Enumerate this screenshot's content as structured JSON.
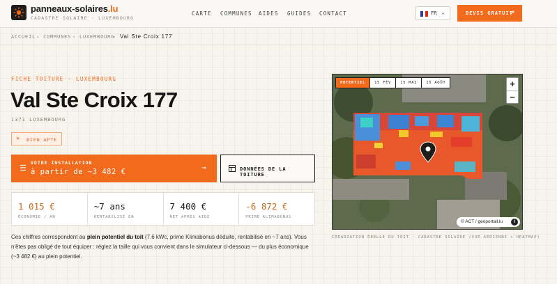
{
  "brand": {
    "name": "panneaux-solaires",
    "tld": ".lu",
    "subtitle": "CADASTRE SOLAIRE · LUXEMBOURG"
  },
  "nav": [
    "CARTE",
    "COMMUNES",
    "AIDES",
    "GUIDES",
    "CONTACT"
  ],
  "lang": {
    "code": "FR",
    "flag_colors": [
      "#2a3f91",
      "#ffffff",
      "#e1261c"
    ]
  },
  "cta": {
    "label": "DEVIS GRATUIT",
    "arrow": "↗"
  },
  "breadcrumb": [
    "ACCUEIL",
    "COMMUNES",
    "LUXEMBOURG",
    "Val Ste Croix 177"
  ],
  "breadcrumb_sep": "›",
  "eyebrow": "FICHE TOITURE · LUXEMBOURG",
  "title": "Val Ste Croix 177",
  "locality": "1371 LUXEMBOURG",
  "badge": {
    "label": "BIEN APTE",
    "icon": "sun-icon"
  },
  "install": {
    "label": "VOTRE INSTALLATION",
    "price": "à partir de ~3 482 €",
    "icon": "sliders-icon",
    "arrow": "→"
  },
  "roof_button": {
    "label": "DONNÉES DE LA TOITURE",
    "icon": "table-icon"
  },
  "stats": [
    {
      "value": "1 015 €",
      "label": "ÉCONOMIE / AN",
      "color": "#c96a1c"
    },
    {
      "value": "~7 ans",
      "label": "RENTABILISÉ EN",
      "color": "#1a1a1a"
    },
    {
      "value": "7 400 €",
      "label": "NET APRÈS AIDE",
      "color": "#1a1a1a"
    },
    {
      "value": "-6 872 €",
      "label": "PRIME KLIMABONUS",
      "color": "#c96a1c"
    }
  ],
  "paragraph": {
    "p1": "Ces chiffres correspondent au ",
    "bold": "plein potentiel du toit",
    "p2": " (7.6 kWc, prime Klimabonus déduite, rentabilisé en ~7 ans). Vous n'êtes pas obligé de tout équiper : réglez la taille qui vous convient dans le simulateur ci-dessous — du plus économique (~3 482 €) au plein potentiel."
  },
  "map": {
    "tabs": [
      "POTENTIEL",
      "15 FÉV",
      "15 MAI",
      "15 AOÛT"
    ],
    "active_tab": 0,
    "zoom_in": "+",
    "zoom_out": "−",
    "attribution": "© ACT / geoportail.lu",
    "info": "i",
    "caption": "IRRADIATION RÉELLE DU TOIT · CADASTRE SOLAIRE (VUE AÉRIENNE + HEATMAP)"
  },
  "colors": {
    "accent": "#f26a1b"
  }
}
